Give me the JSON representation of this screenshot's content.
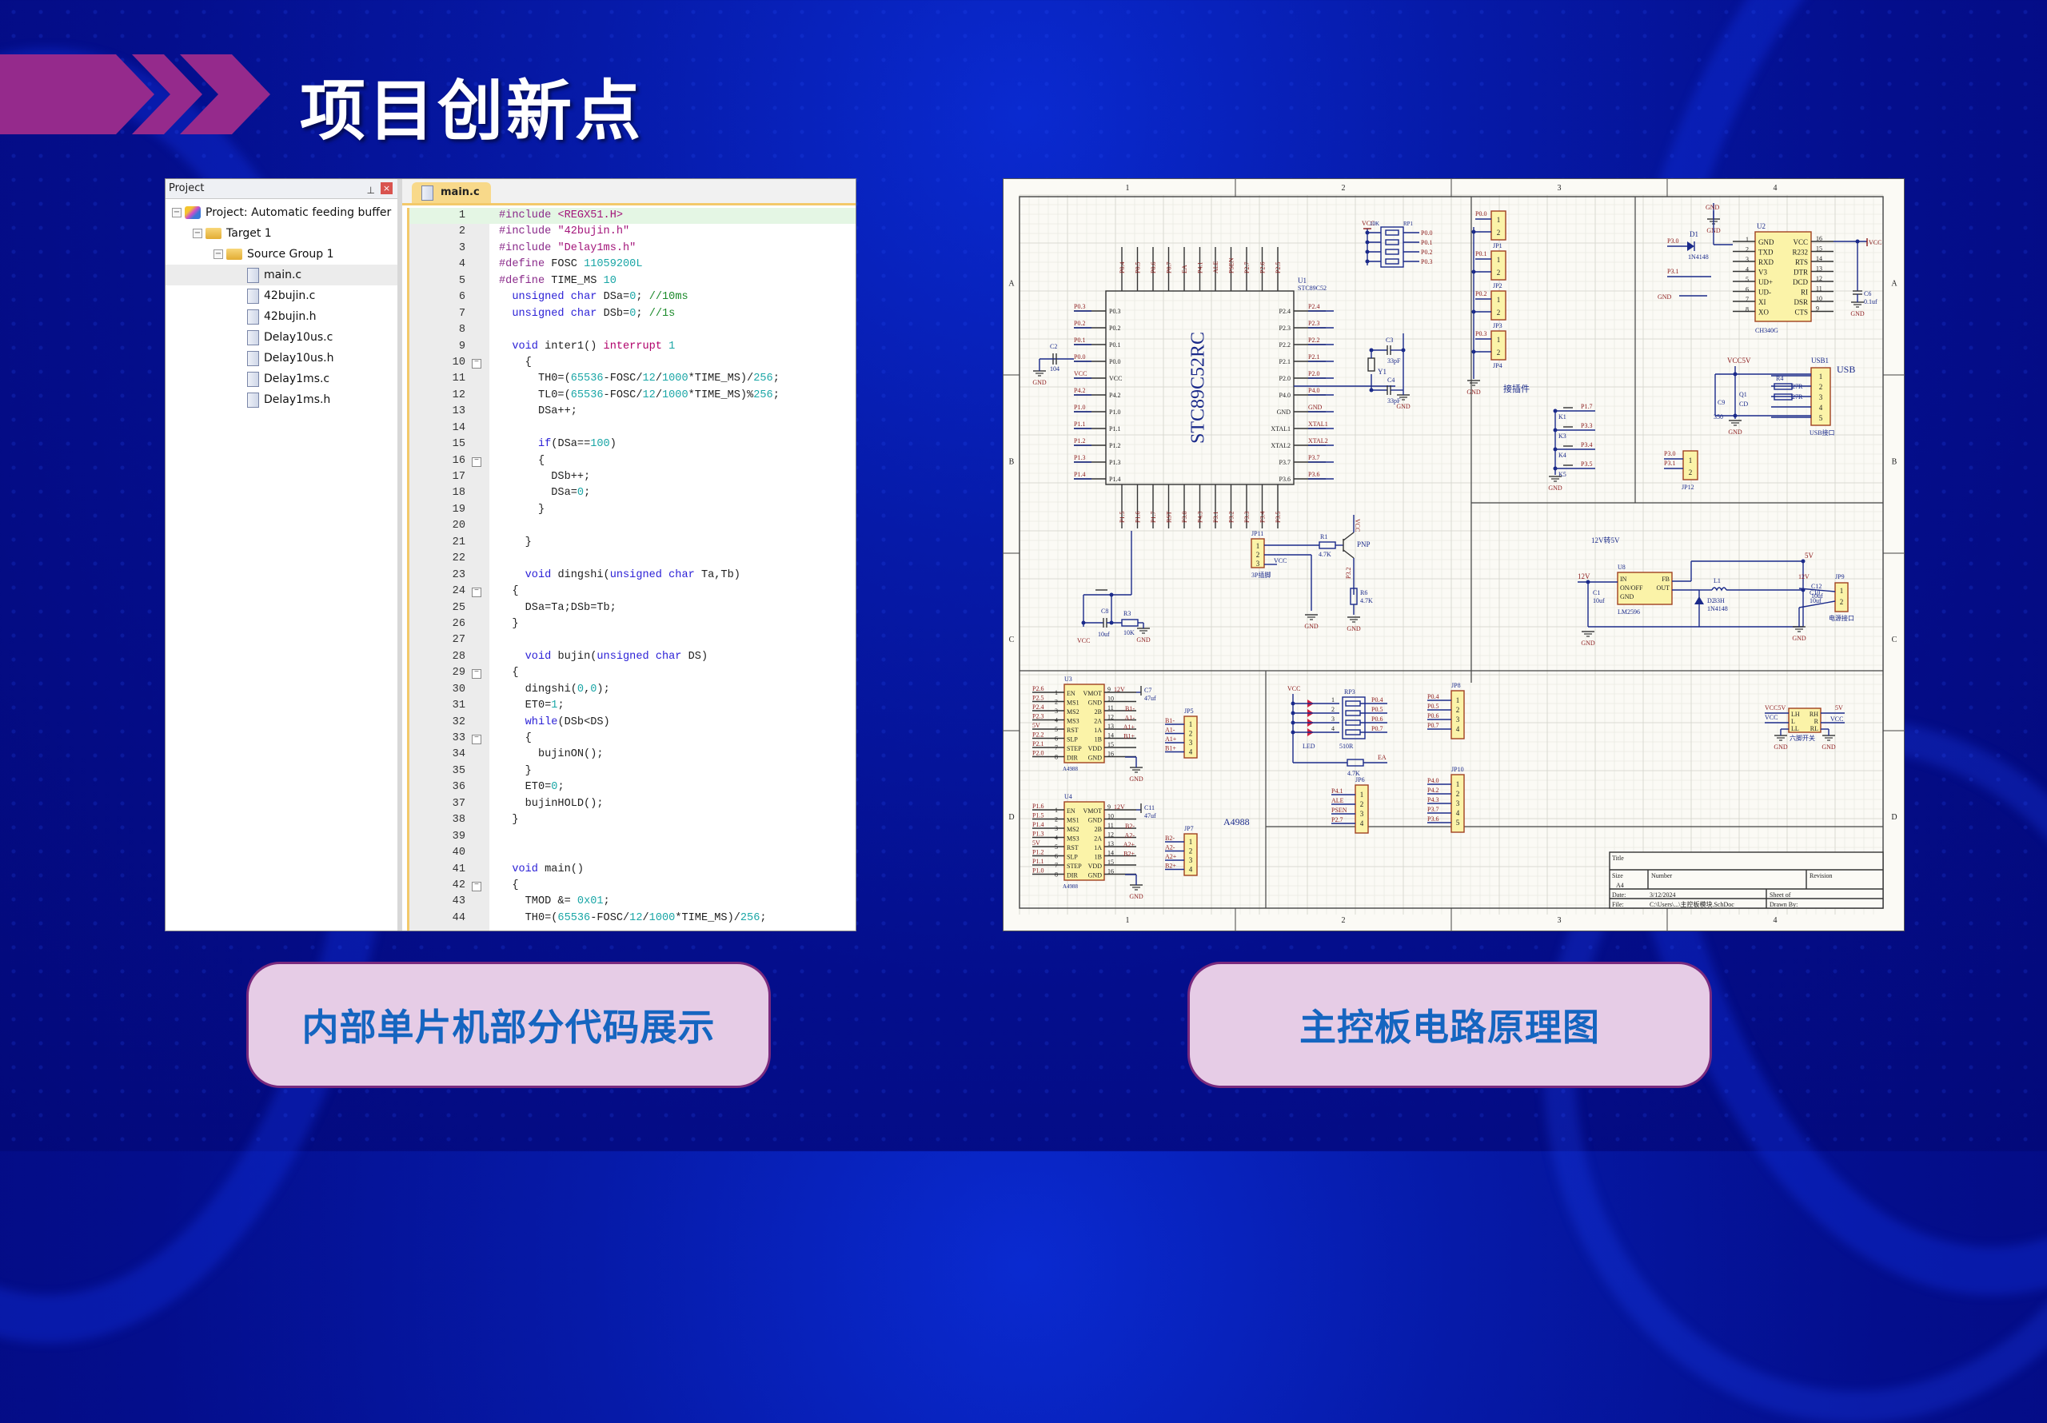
{
  "slide": {
    "title": "项目创新点",
    "colors": {
      "accent_chevron": "#952a8c",
      "button_bg": "#e6cce6",
      "button_text": "#1565c0",
      "background": "#061aa8"
    }
  },
  "ide": {
    "project_pane": {
      "header": "Project",
      "pin_icon": "📌",
      "close_icon": "×",
      "tree": [
        {
          "label": "Project: Automatic feeding buffer",
          "level": 0,
          "type": "project",
          "expanded": true
        },
        {
          "label": "Target 1",
          "level": 1,
          "type": "target",
          "expanded": true
        },
        {
          "label": "Source Group 1",
          "level": 2,
          "type": "folder",
          "expanded": true
        },
        {
          "label": "main.c",
          "level": 3,
          "type": "file",
          "selected": true
        },
        {
          "label": "42bujin.c",
          "level": 3,
          "type": "file"
        },
        {
          "label": "42bujin.h",
          "level": 3,
          "type": "file"
        },
        {
          "label": "Delay10us.c",
          "level": 3,
          "type": "file"
        },
        {
          "label": "Delay10us.h",
          "level": 3,
          "type": "file"
        },
        {
          "label": "Delay1ms.c",
          "level": 3,
          "type": "file"
        },
        {
          "label": "Delay1ms.h",
          "level": 3,
          "type": "file"
        }
      ]
    },
    "editor": {
      "active_tab": "main.c",
      "lines": [
        {
          "n": 1,
          "code": "#include <REGX51.H>"
        },
        {
          "n": 2,
          "code": "#include \"42bujin.h\""
        },
        {
          "n": 3,
          "code": "#include \"Delay1ms.h\""
        },
        {
          "n": 4,
          "code": "#define FOSC 11059200L"
        },
        {
          "n": 5,
          "code": "#define TIME_MS 10"
        },
        {
          "n": 6,
          "code": "  unsigned char DSa=0; //10ms"
        },
        {
          "n": 7,
          "code": "  unsigned char DSb=0; //1s"
        },
        {
          "n": 8,
          "code": ""
        },
        {
          "n": 9,
          "code": "  void inter1() interrupt 1"
        },
        {
          "n": 10,
          "code": "    {",
          "fold": true
        },
        {
          "n": 11,
          "code": "      TH0=(65536-FOSC/12/1000*TIME_MS)/256;"
        },
        {
          "n": 12,
          "code": "      TL0=(65536-FOSC/12/1000*TIME_MS)%256;"
        },
        {
          "n": 13,
          "code": "      DSa++;"
        },
        {
          "n": 14,
          "code": ""
        },
        {
          "n": 15,
          "code": "      if(DSa==100)"
        },
        {
          "n": 16,
          "code": "      {",
          "fold": true
        },
        {
          "n": 17,
          "code": "        DSb++;"
        },
        {
          "n": 18,
          "code": "        DSa=0;"
        },
        {
          "n": 19,
          "code": "      }"
        },
        {
          "n": 20,
          "code": ""
        },
        {
          "n": 21,
          "code": "    }"
        },
        {
          "n": 22,
          "code": ""
        },
        {
          "n": 23,
          "code": "    void dingshi(unsigned char Ta,Tb)"
        },
        {
          "n": 24,
          "code": "  {",
          "fold": true
        },
        {
          "n": 25,
          "code": "    DSa=Ta;DSb=Tb;"
        },
        {
          "n": 26,
          "code": "  }"
        },
        {
          "n": 27,
          "code": ""
        },
        {
          "n": 28,
          "code": "    void bujin(unsigned char DS)"
        },
        {
          "n": 29,
          "code": "  {",
          "fold": true
        },
        {
          "n": 30,
          "code": "    dingshi(0,0);"
        },
        {
          "n": 31,
          "code": "    ET0=1;"
        },
        {
          "n": 32,
          "code": "    while(DSb<DS)"
        },
        {
          "n": 33,
          "code": "    {",
          "fold": true
        },
        {
          "n": 34,
          "code": "      bujinON();"
        },
        {
          "n": 35,
          "code": "    }"
        },
        {
          "n": 36,
          "code": "    ET0=0;"
        },
        {
          "n": 37,
          "code": "    bujinHOLD();"
        },
        {
          "n": 38,
          "code": "  }"
        },
        {
          "n": 39,
          "code": ""
        },
        {
          "n": 40,
          "code": ""
        },
        {
          "n": 41,
          "code": "  void main()"
        },
        {
          "n": 42,
          "code": "  {",
          "fold": true
        },
        {
          "n": 43,
          "code": "    TMOD &= 0x01;"
        },
        {
          "n": 44,
          "code": "    TH0=(65536-FOSC/12/1000*TIME_MS)/256;"
        }
      ]
    }
  },
  "schematic": {
    "col_labels": [
      "1",
      "2",
      "3",
      "4"
    ],
    "row_labels": [
      "A",
      "B",
      "C",
      "D"
    ],
    "mcu": {
      "ref": "U1",
      "part": "STC89C52",
      "name": "STC89C52RC",
      "left_pins": [
        "P0.3",
        "P0.2",
        "P0.1",
        "P0.0",
        "VCC",
        "P4.2",
        "P1.0",
        "P1.1",
        "P1.2",
        "P1.3",
        "P1.4"
      ],
      "right_pins": [
        "P2.4",
        "P2.3",
        "P2.2",
        "P2.1",
        "P2.0",
        "P4.0",
        "GND",
        "XTAL1",
        "XTAL2",
        "P3.7",
        "P3.6"
      ],
      "top_pins": [
        "P0.4",
        "P0.5",
        "P0.6",
        "P0.7",
        "EA",
        "P4.1",
        "ALE",
        "PSEN",
        "P2.7",
        "P2.6",
        "P2.5"
      ],
      "bottom_pins": [
        "P1.5",
        "P1.6",
        "P1.7",
        "RST",
        "P3.0",
        "P4.3",
        "P3.1",
        "P3.2",
        "P3.3",
        "P3.4",
        "P3.5"
      ]
    },
    "labels": {
      "rp1": "RP1",
      "rp1_val": "10K",
      "vcc": "VCC",
      "gnd": "GND",
      "c2": "C2",
      "c2_val": "104",
      "c3": "C3",
      "c3_val": "33pF",
      "c4": "C4",
      "c4_val": "33pF",
      "y1": "Y1",
      "connectors_caption": "接插件",
      "jp": [
        "JP1",
        "JP2",
        "JP3",
        "JP4"
      ],
      "jp_nets": [
        "P0.0",
        "P0.1",
        "P0.2",
        "P0.3"
      ],
      "u2": "U2",
      "u2_part": "CH340G",
      "u2_left": [
        "GND",
        "TXD",
        "RXD",
        "V3",
        "UD+",
        "UD-",
        "XI",
        "XO"
      ],
      "u2_right": [
        "VCC",
        "R232",
        "RTS",
        "DTR",
        "DCD",
        "RI",
        "DSR",
        "CTS"
      ],
      "d1": "D1",
      "d1_val": "1N4148",
      "p30": "P3.0",
      "p31": "P3.1",
      "c6": "C6",
      "c6_val": "0.1uf",
      "usb_title": "USB",
      "usb1": "USB1",
      "usb_caption": "USB接口",
      "vcc5v": "VCC5V",
      "r4": "R4",
      "r5": "R5",
      "r_val": "27R",
      "c9": "C9",
      "c9_val": "350",
      "q1": "Q1",
      "q1_val": "CD",
      "keys": [
        "K1",
        "K3",
        "K4",
        "K5"
      ],
      "key_nets": [
        "P1.7",
        "P3.3",
        "P3.4",
        "P3.5"
      ],
      "jp12": "JP12",
      "jp11": "JP11",
      "jp11_caption": "3P插脚",
      "r1": "R1",
      "r1_val": "4.7K",
      "pnp": "PNP",
      "r6": "R6",
      "r6_val": "4.7K",
      "p32": "P3.2",
      "c8": "C8",
      "c8_val": "10uf",
      "r3": "R3",
      "r3_val": "10K",
      "reg_caption": "12V转5V",
      "u8": "U8",
      "u8_part": "LM2596",
      "u8_pins": [
        "IN",
        "ON/OFF",
        "GND",
        "FB",
        "OUT"
      ],
      "l1": "L1",
      "l1_val": "33H",
      "d2": "D2",
      "d2_val": "1N4148",
      "c1": "C1",
      "c1_val": "10uf",
      "c10": "C10",
      "c10_val": "10uf",
      "v12": "12V",
      "v5": "5V",
      "c12": "C12",
      "c12_val": "10uf",
      "jp9": "JP9",
      "jp9_caption": "电源接口",
      "u3": "U3",
      "u4": "U4",
      "a4988": "A4988",
      "drv_left": [
        "EN",
        "MS1",
        "MS2",
        "MS3",
        "RST",
        "SLP",
        "STEP",
        "DIR"
      ],
      "drv_right": [
        "VMOT",
        "GND",
        "2B",
        "2A",
        "1A",
        "1B",
        "VDD",
        "GND"
      ],
      "u3_nets": [
        "P2.6",
        "P2.5",
        "P2.4",
        "P2.3",
        "5V",
        "P2.2",
        "P2.1",
        "P2.0"
      ],
      "u4_nets": [
        "P1.6",
        "P1.5",
        "P1.4",
        "P1.3",
        "5V",
        "P1.2",
        "P1.1",
        "P1.0"
      ],
      "c7": "C7",
      "c7_val": "47uf",
      "c11": "C11",
      "c11_val": "47uf",
      "jp5": "JP5",
      "jp7": "JP7",
      "jp5_nets": [
        "B1-",
        "A1-",
        "A1+",
        "B1+"
      ],
      "jp7_nets": [
        "B2-",
        "A2-",
        "A2+",
        "B2+"
      ],
      "rp3": "RP3",
      "rp3_val": "510R",
      "led": "LED",
      "ea": "EA",
      "jp8": "JP8",
      "jp8_nets": [
        "P0.4",
        "P0.5",
        "P0.6",
        "P0.7"
      ],
      "jp6": "JP6",
      "jp6_nets": [
        "P4.1",
        "ALE",
        "PSEN",
        "P2.7"
      ],
      "jp10": "JP10",
      "jp10_nets": [
        "P4.0",
        "P4.2",
        "P4.3",
        "P3.7",
        "P3.6"
      ],
      "sw_caption": "六脚开关",
      "sw_pins": [
        "LH",
        "L",
        "LL",
        "RH",
        "R",
        "RL"
      ],
      "tb_title": "Title",
      "tb_size": "Size",
      "tb_size_val": "A4",
      "tb_number": "Number",
      "tb_revision": "Revision",
      "tb_date": "Date:",
      "tb_date_val": "3/12/2024",
      "tb_file": "File:",
      "tb_file_val": "C:\\Users\\...\\主控板模块.SchDoc",
      "tb_sheet": "Sheet  of",
      "tb_drawn": "Drawn By:"
    }
  },
  "buttons": {
    "code_demo": "内部单片机部分代码展示",
    "schematic": "主控板电路原理图"
  }
}
